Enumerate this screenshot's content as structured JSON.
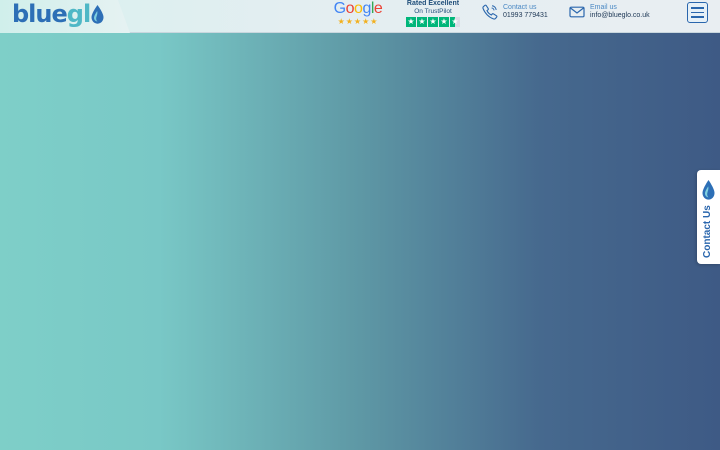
{
  "header": {
    "logo": {
      "part1": "blue",
      "part2": "gl"
    },
    "google": {
      "letters": [
        "G",
        "o",
        "o",
        "g",
        "l",
        "e"
      ],
      "stars": "★★★★★"
    },
    "trustpilot": {
      "rated": "Rated Excellent",
      "on": "On TrustPilot",
      "star_glyph": "★"
    },
    "phone": {
      "label": "Contact us",
      "value": "01993 779431",
      "icon": "phone-icon"
    },
    "email": {
      "label": "Email us",
      "value": "info@blueglo.co.uk",
      "icon": "mail-icon"
    },
    "menu_icon": "hamburger-icon"
  },
  "side_tab": {
    "label": "Contact Us",
    "icon": "water-drop-icon"
  },
  "colors": {
    "brand_blue": "#2d6fb6",
    "brand_teal": "#4fb8c6",
    "gradient_start": "#7ecfc8",
    "gradient_end": "#3e5a85",
    "trustpilot_green": "#00b67a",
    "google_star": "#f2b01e"
  }
}
